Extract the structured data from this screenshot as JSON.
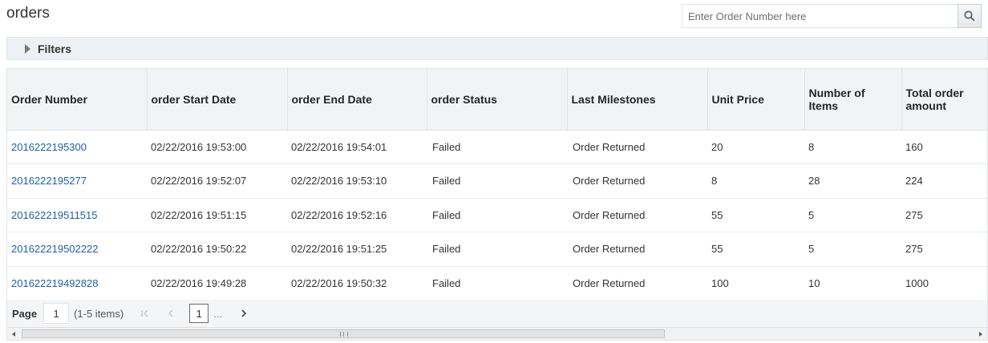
{
  "page": {
    "title": "orders"
  },
  "search": {
    "placeholder": "Enter Order Number here",
    "icon": "search-icon"
  },
  "filters": {
    "label": "Filters",
    "icon": "triangle-right-icon"
  },
  "table": {
    "columns": [
      "Order Number",
      "order Start Date",
      "order End Date",
      "order Status",
      "Last Milestones",
      "Unit Price",
      "Number of Items",
      "Total order amount"
    ],
    "rows": [
      [
        "2016222195300",
        "02/22/2016 19:53:00",
        "02/22/2016 19:54:01",
        "Failed",
        "Order Returned",
        "20",
        "8",
        "160"
      ],
      [
        "2016222195277",
        "02/22/2016 19:52:07",
        "02/22/2016 19:53:10",
        "Failed",
        "Order Returned",
        "8",
        "28",
        "224"
      ],
      [
        "201622219511515",
        "02/22/2016 19:51:15",
        "02/22/2016 19:52:16",
        "Failed",
        "Order Returned",
        "55",
        "5",
        "275"
      ],
      [
        "201622219502222",
        "02/22/2016 19:50:22",
        "02/22/2016 19:51:25",
        "Failed",
        "Order Returned",
        "55",
        "5",
        "275"
      ],
      [
        "201622219492828",
        "02/22/2016 19:49:28",
        "02/22/2016 19:50:32",
        "Failed",
        "Order Returned",
        "100",
        "10",
        "1000"
      ]
    ]
  },
  "pager": {
    "label": "Page",
    "current_page": "1",
    "count_text": "(1-5 items)",
    "page_number": "1",
    "ellipsis": "..."
  },
  "colors": {
    "link": "#1f5fa8",
    "header_bg": "#f1f3f5",
    "border": "#dfe4ea"
  }
}
